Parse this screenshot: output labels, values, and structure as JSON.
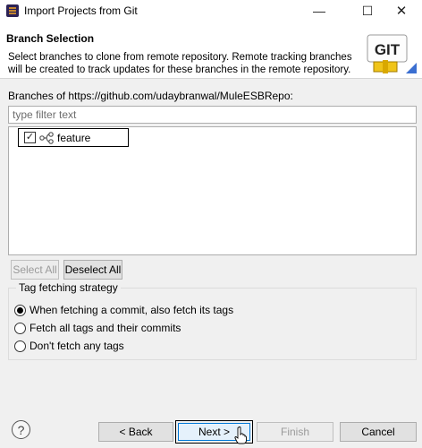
{
  "window": {
    "title": "Import Projects from Git"
  },
  "header": {
    "title": "Branch Selection",
    "description": "Select branches to clone from remote repository. Remote tracking branches will be created to track updates for these branches in the remote repository.",
    "banner_text": "GIT"
  },
  "branches": {
    "label": "Branches of https://github.com/udaybranwal/MuleESBRepo:",
    "filter_placeholder": "type filter text",
    "items": [
      {
        "label": "feature",
        "checked": true
      }
    ]
  },
  "selection_buttons": {
    "select_all": "Select All",
    "deselect_all": "Deselect All"
  },
  "tag_fetching": {
    "title": "Tag fetching strategy",
    "options": [
      {
        "label": "When fetching a commit, also fetch its tags",
        "selected": true
      },
      {
        "label": "Fetch all tags and their commits",
        "selected": false
      },
      {
        "label": "Don't fetch any tags",
        "selected": false
      }
    ]
  },
  "footer": {
    "help": "?",
    "back": "< Back",
    "next": "Next >",
    "finish": "Finish",
    "cancel": "Cancel"
  }
}
